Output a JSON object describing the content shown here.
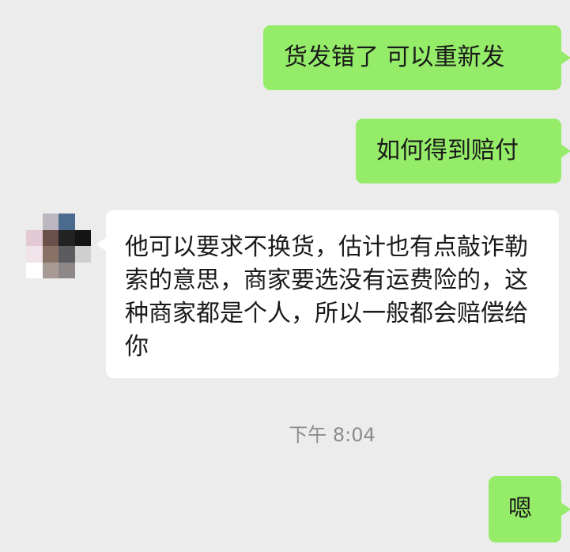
{
  "messages": [
    {
      "sender": "me",
      "text": "货发错了 可以重新发"
    },
    {
      "sender": "me",
      "text": "如何得到赔付"
    },
    {
      "sender": "other",
      "text": "他可以要求不换货，估计也有点敲诈勒索的意思，商家要选没有运费险的，这种商家都是个人，所以一般都会赔偿给你"
    },
    {
      "sender": "me",
      "text": "嗯"
    }
  ],
  "timestamp": "下午 8:04",
  "colors": {
    "background": "#ececec",
    "my_bubble": "#95ec69",
    "other_bubble": "#ffffff",
    "timestamp_text": "#8c8c8c"
  },
  "avatar": {
    "style": "pixelated"
  }
}
